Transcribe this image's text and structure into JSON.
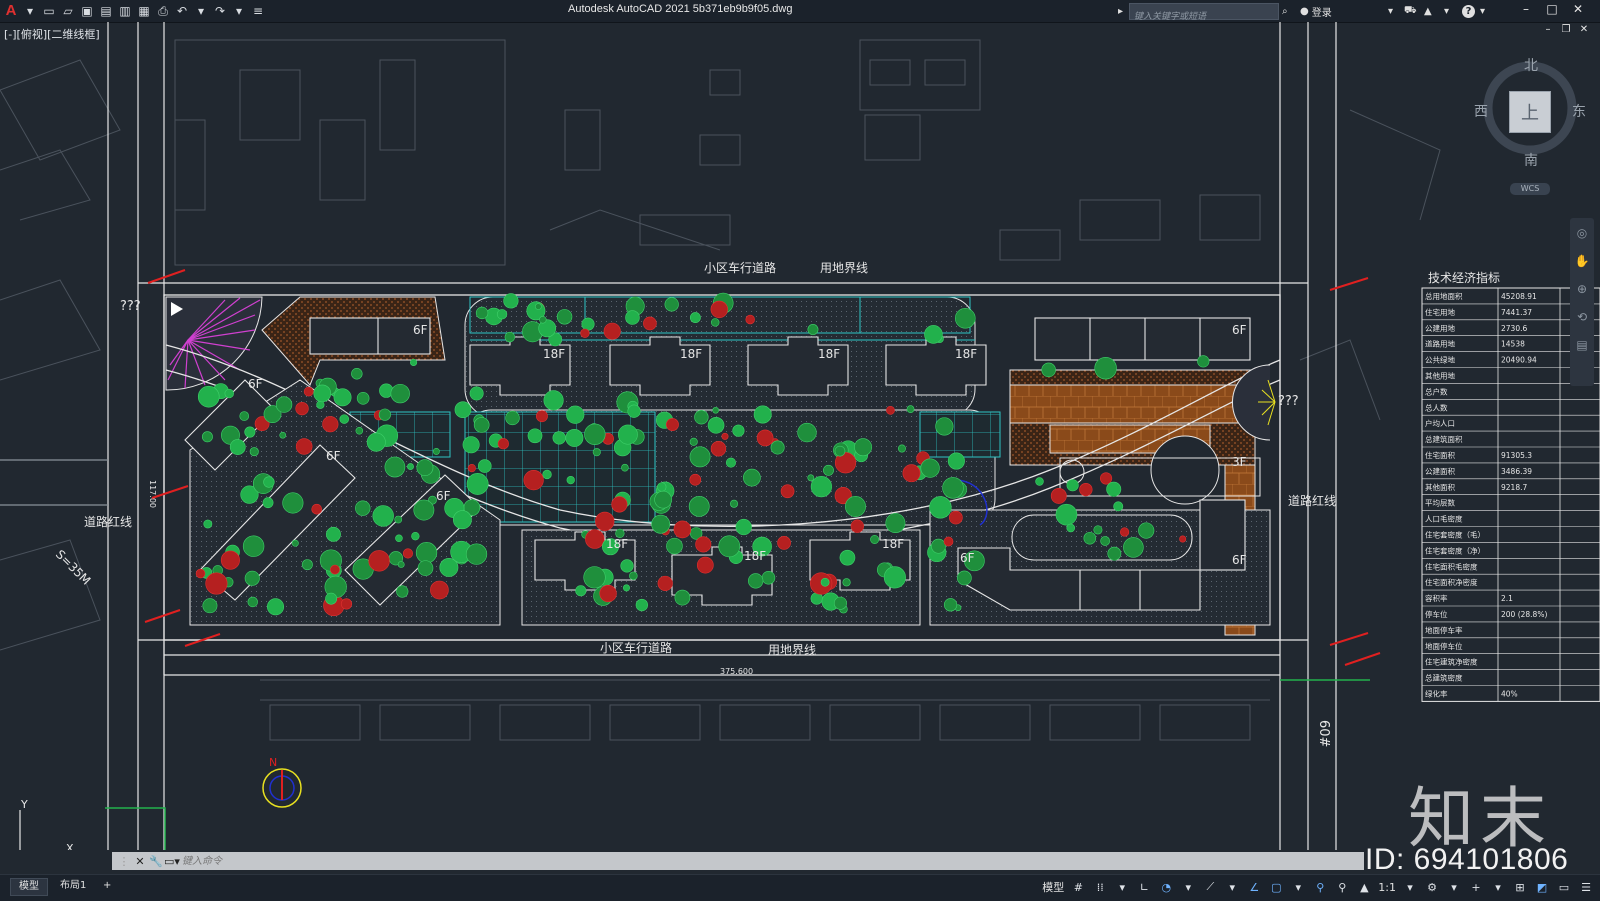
{
  "titlebar": {
    "app_title": "Autodesk AutoCAD 2021    5b371eb9b9f05.dwg",
    "app_logo": "A",
    "search_placeholder": "键入关键字或短语",
    "login_label": "登录",
    "help_label": "?"
  },
  "viewport": {
    "label": "[-][俯视][二维线框]"
  },
  "viewcube": {
    "north": "北",
    "south": "南",
    "east": "东",
    "west": "西",
    "top": "上",
    "wcs": "WCS"
  },
  "drawing": {
    "road_top": "小区车行道路",
    "boundary_top": "用地界线",
    "road_bottom": "小区车行道路",
    "boundary_bottom": "用地界线",
    "red_line_left": "道路红线",
    "red_line_right": "道路红线",
    "left_road_width": "S=35M",
    "dim_bottom": "375.600",
    "dim_left": "117.00",
    "right_road": "60#",
    "unknown_left": "???",
    "unknown_right": "???",
    "north_mark": "N",
    "floors": {
      "b6f_top_left": "6F",
      "b18f_1": "18F",
      "b18f_2": "18F",
      "b18f_3": "18F",
      "b18f_4": "18F",
      "b6f_top_right": "6F",
      "b6f_left_1": "6F",
      "b6f_left_2": "6F",
      "b6f_left_3": "6F",
      "b18f_bottom_1": "18F",
      "b18f_bottom_2": "18F",
      "b18f_bottom_3": "18F",
      "b3f": "3F",
      "b6f_br_1": "6F",
      "b6f_br_2": "6F"
    }
  },
  "indicator_table": {
    "title": "技术经济指标",
    "rows": [
      {
        "label": "总用地面积",
        "value": "45208.91"
      },
      {
        "label": "住宅用地",
        "value": "7441.37"
      },
      {
        "label": "公建用地",
        "value": "2730.6"
      },
      {
        "label": "道路用地",
        "value": "14538"
      },
      {
        "label": "公共绿地",
        "value": "20490.94"
      },
      {
        "label": "其他用地",
        "value": ""
      },
      {
        "label": "总户数",
        "value": ""
      },
      {
        "label": "总人数",
        "value": ""
      },
      {
        "label": "户均人口",
        "value": ""
      },
      {
        "label": "总建筑面积",
        "value": ""
      },
      {
        "label": "住宅面积",
        "value": "91305.3"
      },
      {
        "label": "公建面积",
        "value": "3486.39"
      },
      {
        "label": "其他面积",
        "value": "9218.7"
      },
      {
        "label": "平均层数",
        "value": ""
      },
      {
        "label": "人口毛密度",
        "value": ""
      },
      {
        "label": "住宅套密度（毛）",
        "value": ""
      },
      {
        "label": "住宅套密度（净）",
        "value": ""
      },
      {
        "label": "住宅面积毛密度",
        "value": ""
      },
      {
        "label": "住宅面积净密度",
        "value": ""
      },
      {
        "label": "容积率",
        "value": "2.1"
      },
      {
        "label": "停车位",
        "value": "200 (28.8%)"
      },
      {
        "label": "地面停车率",
        "value": ""
      },
      {
        "label": "地面停车位",
        "value": ""
      },
      {
        "label": "住宅建筑净密度",
        "value": ""
      },
      {
        "label": "总建筑密度",
        "value": ""
      },
      {
        "label": "绿化率",
        "value": "40%"
      }
    ]
  },
  "command": {
    "placeholder": "键入命令"
  },
  "statusbar": {
    "tab_model": "模型",
    "tab_layout1": "布局1",
    "tab_add": "+",
    "model_label": "模型",
    "scale": "1:1"
  },
  "watermark": {
    "logo": "知末",
    "id": "ID: 694101806"
  },
  "colors": {
    "background": "#212830",
    "line_white": "#e6e6e6",
    "tree_green": "#22b14c",
    "hatch_brown": "#8a4a1a",
    "grid_cyan": "#2ec4c4",
    "red_label": "#e02020",
    "magenta": "#d040d0",
    "yellow": "#e8e020"
  }
}
